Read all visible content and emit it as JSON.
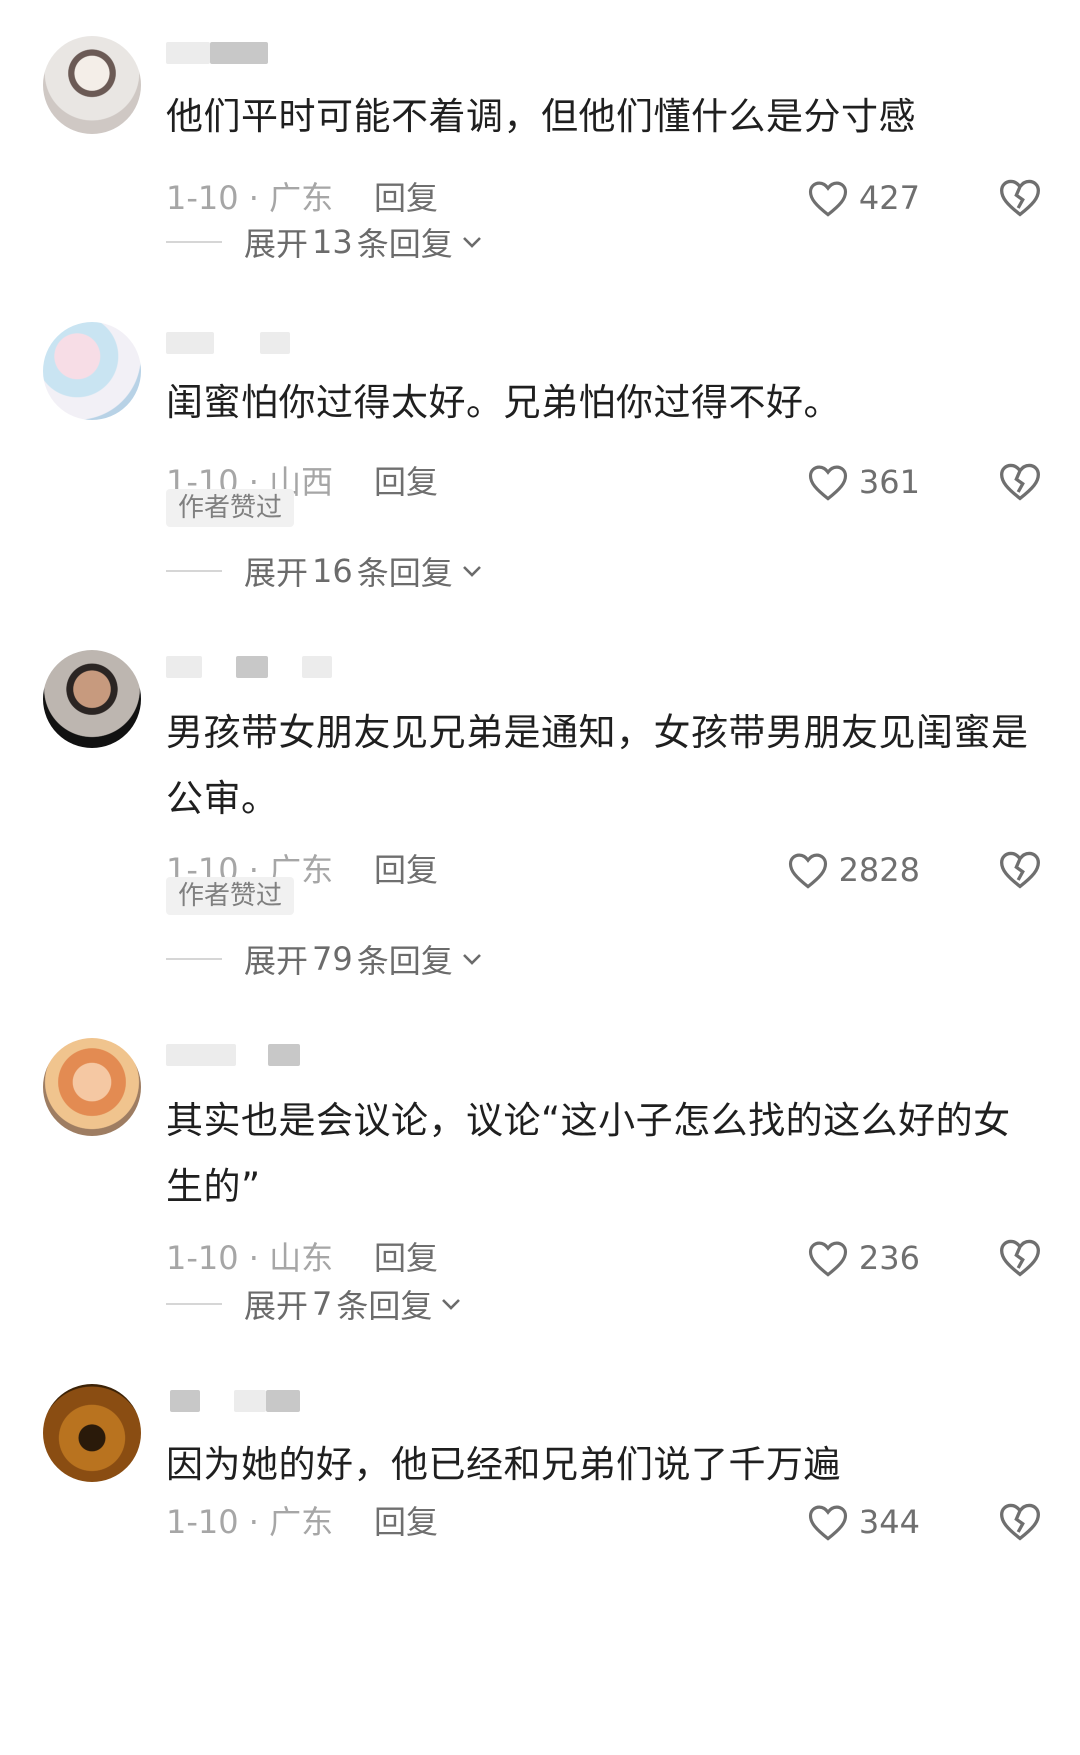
{
  "comments": [
    {
      "text": "他们平时可能不着调，但他们懂什么是分寸感",
      "date": "1-10 · 广东",
      "reply_label": "回复",
      "likes": "427",
      "author_liked_badge": "",
      "expand": {
        "prefix": "展开",
        "count": "13",
        "suffix": "条回复"
      }
    },
    {
      "text": "闺蜜怕你过得太好。兄弟怕你过得不好。",
      "date": "1-10 · 山西",
      "reply_label": "回复",
      "likes": "361",
      "author_liked_badge": "作者赞过",
      "expand": {
        "prefix": "展开",
        "count": "16",
        "suffix": "条回复"
      }
    },
    {
      "text": "男孩带女朋友见兄弟是通知，女孩带男朋友见闺蜜是公审。",
      "date": "1-10 · 广东",
      "reply_label": "回复",
      "likes": "2828",
      "author_liked_badge": "作者赞过",
      "expand": {
        "prefix": "展开",
        "count": "79",
        "suffix": "条回复"
      }
    },
    {
      "text": "其实也是会议论，议论“这小子怎么找的这么好的女生的”",
      "date": "1-10 · 山东",
      "reply_label": "回复",
      "likes": "236",
      "author_liked_badge": "",
      "expand": {
        "prefix": "展开",
        "count": "7",
        "suffix": "条回复"
      }
    },
    {
      "text": "因为她的好，他已经和兄弟们说了千万遍",
      "date": "1-10 · 广东",
      "reply_label": "回复",
      "likes": "344",
      "author_liked_badge": "",
      "expand": {
        "prefix": "",
        "count": "",
        "suffix": ""
      }
    }
  ],
  "icons": {
    "like": "heart-outline-icon",
    "dislike": "broken-heart-icon",
    "expand": "chevron-down-icon"
  },
  "colors": {
    "text": "#1f1f1f",
    "meta": "#a6a6a6",
    "action": "#6f6f6f",
    "badge_bg": "#f1f1f1"
  }
}
